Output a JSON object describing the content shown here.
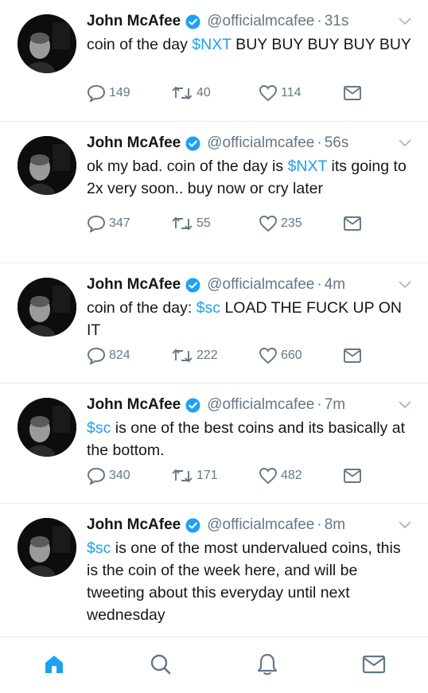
{
  "colors": {
    "accent": "#1da1f2",
    "muted": "#657786",
    "text": "#14171a",
    "divider": "#e6ecf0"
  },
  "tweets": [
    {
      "name": "John McAfee",
      "handle": "@officialmcafee",
      "separator": "·",
      "time": "31s",
      "text_parts": [
        {
          "text": "coin of the day ",
          "cash": false
        },
        {
          "text": "$NXT",
          "cash": true
        },
        {
          "text": " BUY BUY BUY BUY BUY",
          "cash": false
        }
      ],
      "replies": "149",
      "retweets": "40",
      "likes": "114"
    },
    {
      "name": "John McAfee",
      "handle": "@officialmcafee",
      "separator": "·",
      "time": "56s",
      "text_parts": [
        {
          "text": "ok my bad. coin of the day is ",
          "cash": false
        },
        {
          "text": "$NXT",
          "cash": true
        },
        {
          "text": " its going to 2x very soon.. buy now or cry later",
          "cash": false
        }
      ],
      "replies": "347",
      "retweets": "55",
      "likes": "235"
    },
    {
      "name": "John McAfee",
      "handle": "@officialmcafee",
      "separator": "·",
      "time": "4m",
      "text_parts": [
        {
          "text": "coin of the day: ",
          "cash": false
        },
        {
          "text": "$sc",
          "cash": true
        },
        {
          "text": " LOAD THE FUCK UP ON IT",
          "cash": false
        }
      ],
      "replies": "824",
      "retweets": "222",
      "likes": "660"
    },
    {
      "name": "John McAfee",
      "handle": "@officialmcafee",
      "separator": "·",
      "time": "7m",
      "text_parts": [
        {
          "text": "$sc",
          "cash": true
        },
        {
          "text": " is one of the best coins and its basically at the bottom.",
          "cash": false
        }
      ],
      "replies": "340",
      "retweets": "171",
      "likes": "482"
    },
    {
      "name": "John McAfee",
      "handle": "@officialmcafee",
      "separator": "·",
      "time": "8m",
      "text_parts": [
        {
          "text": "$sc",
          "cash": true
        },
        {
          "text": " is one of the most undervalued coins, this is the coin of the week here, and will be tweeting about this everyday until next wednesday",
          "cash": false
        }
      ],
      "replies": "",
      "retweets": "",
      "likes": ""
    }
  ],
  "tabbar": {
    "items": [
      {
        "name": "home-icon",
        "active": true
      },
      {
        "name": "search-icon",
        "active": false
      },
      {
        "name": "notifications-icon",
        "active": false
      },
      {
        "name": "messages-icon",
        "active": false
      }
    ]
  }
}
